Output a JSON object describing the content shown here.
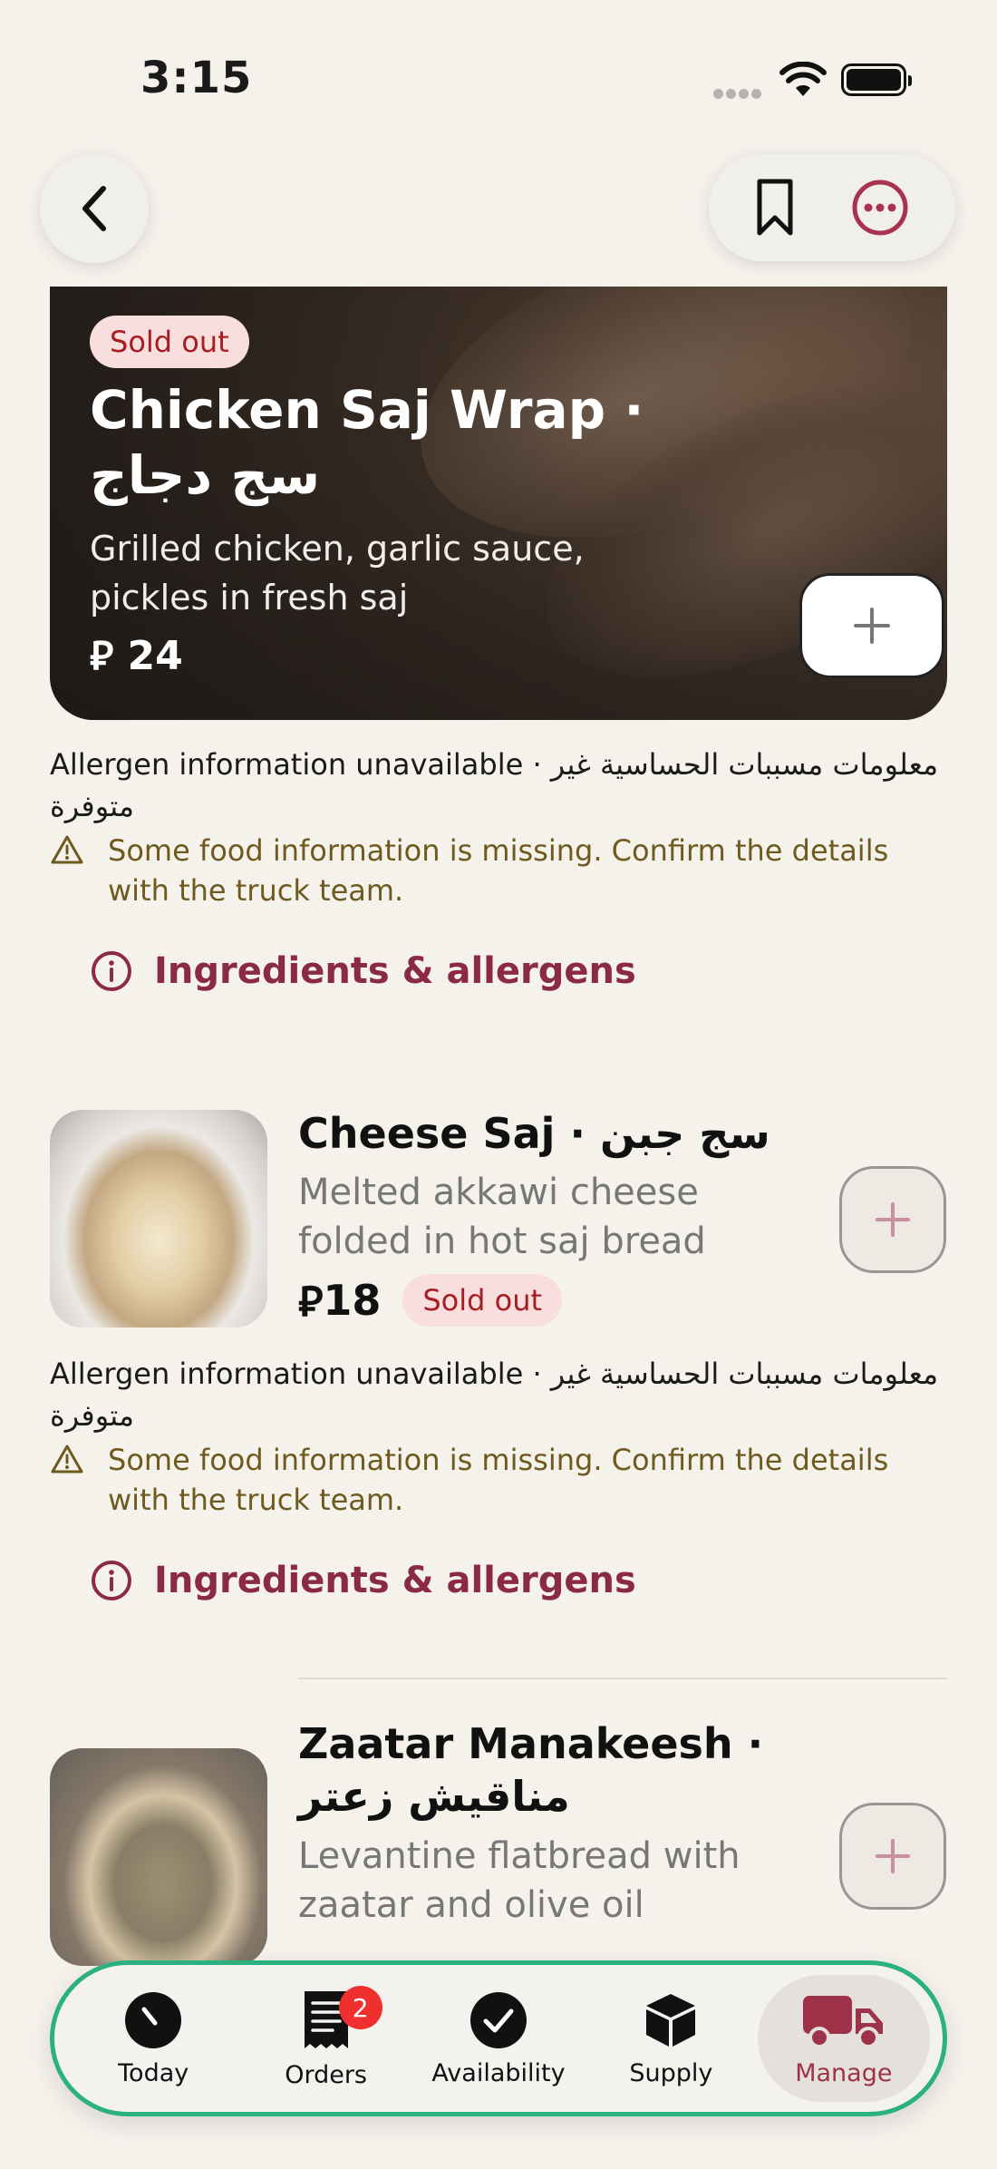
{
  "status_bar": {
    "time": "3:15"
  },
  "hero_item": {
    "badge": "Sold out",
    "title": "Chicken Saj Wrap · سج دجاج",
    "description": "Grilled chicken, garlic sauce, pickles in fresh saj",
    "currency": "⃁",
    "price": "24",
    "allergen_note": "Allergen information unavailable · معلومات مسببات الحساسية غير متوفرة",
    "warning": "Some food information is missing. Confirm the details with the truck team.",
    "ingredients_link": "Ingredients & allergens"
  },
  "items": [
    {
      "title": "Cheese Saj · سج جبن",
      "description": "Melted akkawi cheese folded in hot saj bread",
      "currency": "⃁",
      "price": "18",
      "badge": "Sold out",
      "allergen_note": "Allergen information unavailable · معلومات مسببات الحساسية غير متوفرة",
      "warning": "Some food information is missing. Confirm the details with the truck team.",
      "ingredients_link": "Ingredients & allergens"
    },
    {
      "title": "Zaatar Manakeesh · مناقيش زعتر",
      "description": "Levantine flatbread with zaatar and olive oil"
    }
  ],
  "tab_bar": {
    "tabs": [
      {
        "label": "Today",
        "icon": "clock-icon"
      },
      {
        "label": "Orders",
        "icon": "receipt-icon",
        "badge": "2"
      },
      {
        "label": "Availability",
        "icon": "checkmark-circle-icon"
      },
      {
        "label": "Supply",
        "icon": "box-icon"
      },
      {
        "label": "Manage",
        "icon": "truck-icon",
        "active": true
      }
    ]
  },
  "colors": {
    "accent": "#9d3249",
    "sold_out": "#a61e23",
    "warning": "#6e5a1e",
    "highlight": "#2bb07f"
  }
}
